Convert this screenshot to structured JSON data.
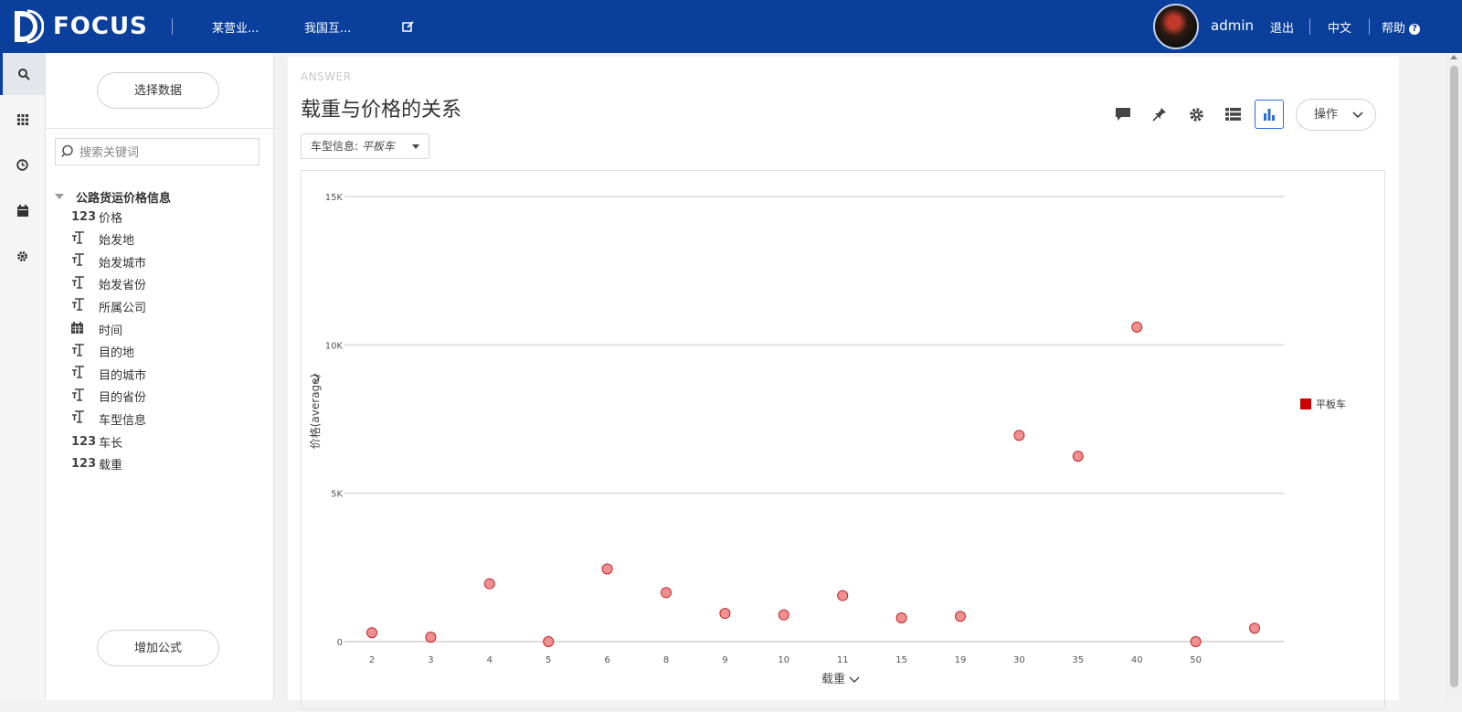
{
  "header": {
    "brand": "FOCUS",
    "tabs": [
      "某营业...",
      "我国互..."
    ],
    "user": "admin",
    "logout": "退出",
    "language": "中文",
    "help": "帮助",
    "help_mark": "?"
  },
  "data_panel": {
    "select_data_label": "选择数据",
    "search_placeholder": "搜索关键词",
    "table_name": "公路货运价格信息",
    "fields": [
      {
        "type": "123",
        "name": "价格"
      },
      {
        "type": "T",
        "name": "始发地"
      },
      {
        "type": "T",
        "name": "始发城市"
      },
      {
        "type": "T",
        "name": "始发省份"
      },
      {
        "type": "T",
        "name": "所属公司"
      },
      {
        "type": "calendar",
        "name": "时间"
      },
      {
        "type": "T",
        "name": "目的地"
      },
      {
        "type": "T",
        "name": "目的城市"
      },
      {
        "type": "T",
        "name": "目的省份"
      },
      {
        "type": "T",
        "name": "车型信息"
      },
      {
        "type": "123",
        "name": "车长"
      },
      {
        "type": "123",
        "name": "载重"
      }
    ],
    "add_formula_label": "增加公式"
  },
  "answer": {
    "tag": "ANSWER",
    "title": "载重与价格的关系",
    "filter_label": "车型信息:",
    "filter_value": "平板车",
    "action_label": "操作"
  },
  "colors": {
    "header_bg": "#0a3f9c",
    "point_fill": "#f08f8f",
    "point_stroke": "#c0262d",
    "legend": "#cc0000"
  },
  "icons": [
    "search-icon",
    "grid-icon",
    "clock-icon",
    "calendar-icon",
    "gear-icon",
    "comment-icon",
    "pin-icon",
    "settings-icon",
    "list-icon",
    "bar-chart-icon",
    "edit-icon",
    "chevron-down-icon"
  ],
  "chart_data": {
    "type": "scatter",
    "categories": [
      "2",
      "3",
      "4",
      "5",
      "6",
      "8",
      "9",
      "10",
      "11",
      "15",
      "19",
      "30",
      "35",
      "40",
      "50",
      ""
    ],
    "series": [
      {
        "name": "平板车",
        "values": [
          300,
          150,
          1950,
          0,
          2450,
          1650,
          950,
          900,
          1550,
          800,
          850,
          6950,
          6250,
          10600,
          0,
          450
        ]
      }
    ],
    "ytick_labels": [
      "0",
      "5K",
      "10K",
      "15K"
    ],
    "yticks": [
      0,
      5000,
      10000,
      15000
    ],
    "ylim": [
      0,
      15000
    ],
    "xlabel": "载重",
    "ylabel": "价格(average)",
    "legend_position": "right",
    "grid": true
  }
}
